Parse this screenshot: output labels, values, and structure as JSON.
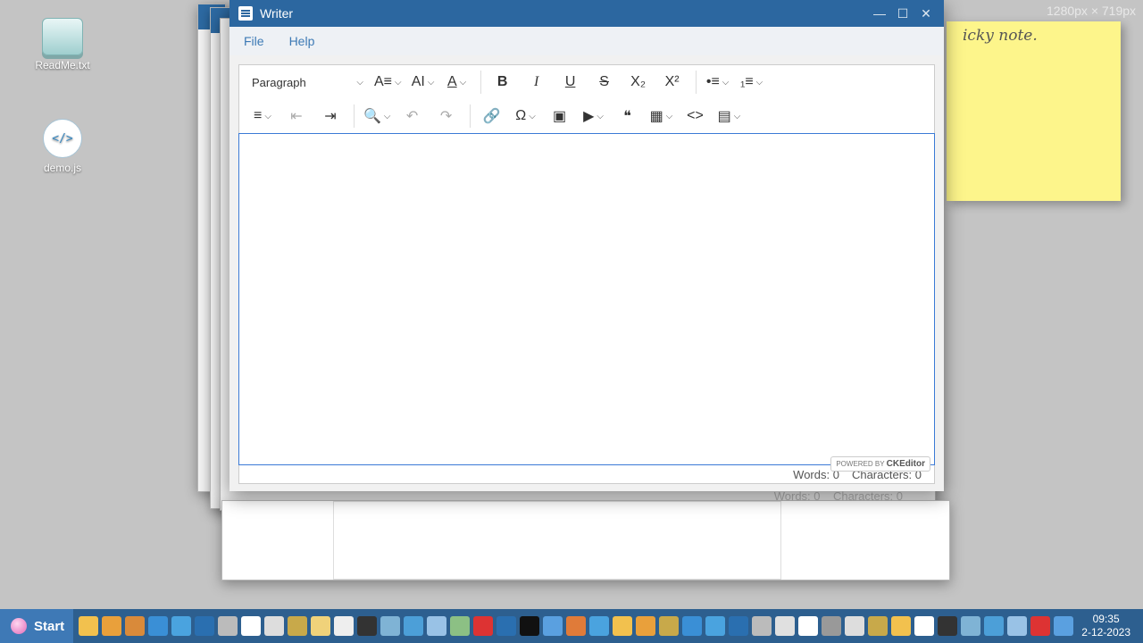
{
  "desktop": {
    "icons": [
      {
        "label": "ReadMe.txt"
      },
      {
        "label": "demo.js"
      }
    ],
    "resolution_label": "1280px × 719px",
    "sticky_text": "icky note."
  },
  "window": {
    "title": "Writer",
    "menu": {
      "file": "File",
      "help": "Help"
    }
  },
  "editor": {
    "paragraph_select": "Paragraph",
    "powered_by": "POWERED BY",
    "brand": "CKEditor",
    "words": "Words: 0",
    "characters": "Characters: 0"
  },
  "ghost": {
    "words": "Words: 0",
    "characters": "Characters: 0"
  },
  "taskbar": {
    "start_label": "Start",
    "time": "09:35",
    "date": "2-12-2023"
  },
  "colors": {
    "titlebar": "#2c67a0",
    "taskbar": "#2d5f8f",
    "sticky": "#fdf58b",
    "accent": "#3b7ad6"
  }
}
